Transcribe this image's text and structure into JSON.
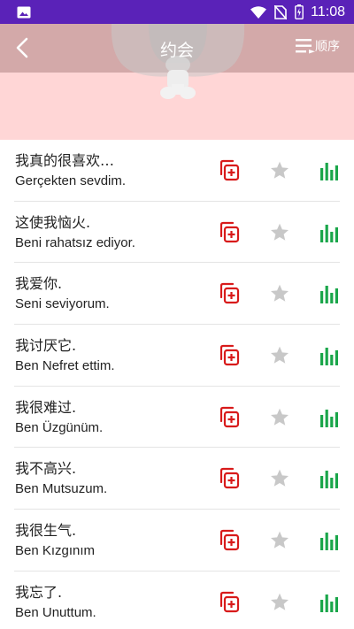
{
  "status_bar": {
    "time": "11:08"
  },
  "header": {
    "title": "约会",
    "sort_label": "顺序"
  },
  "phrases": [
    {
      "chinese": "我真的很喜欢…",
      "turkish": "Gerçekten sevdim."
    },
    {
      "chinese": "这使我恼火.",
      "turkish": "Beni rahatsız ediyor."
    },
    {
      "chinese": "我爱你.",
      "turkish": "Seni seviyorum."
    },
    {
      "chinese": "我讨厌它.",
      "turkish": "Ben Nefret ettim."
    },
    {
      "chinese": "我很难过.",
      "turkish": "Ben Üzgünüm."
    },
    {
      "chinese": "我不高兴.",
      "turkish": "Ben Mutsuzum."
    },
    {
      "chinese": "我很生气.",
      "turkish": "Ben Kızgınım"
    },
    {
      "chinese": "我忘了.",
      "turkish": "Ben Unuttum."
    }
  ],
  "colors": {
    "status_bar": "#5a22b8",
    "header_band": "#d3a9a9",
    "header_bg": "#ffd6d6",
    "copy_icon": "#d81b1b",
    "star_icon": "#c8c8c8",
    "stats_icon": "#1aa64a"
  },
  "icons": {
    "row_actions": [
      "add-to-list-icon",
      "star-icon",
      "stats-icon"
    ]
  }
}
